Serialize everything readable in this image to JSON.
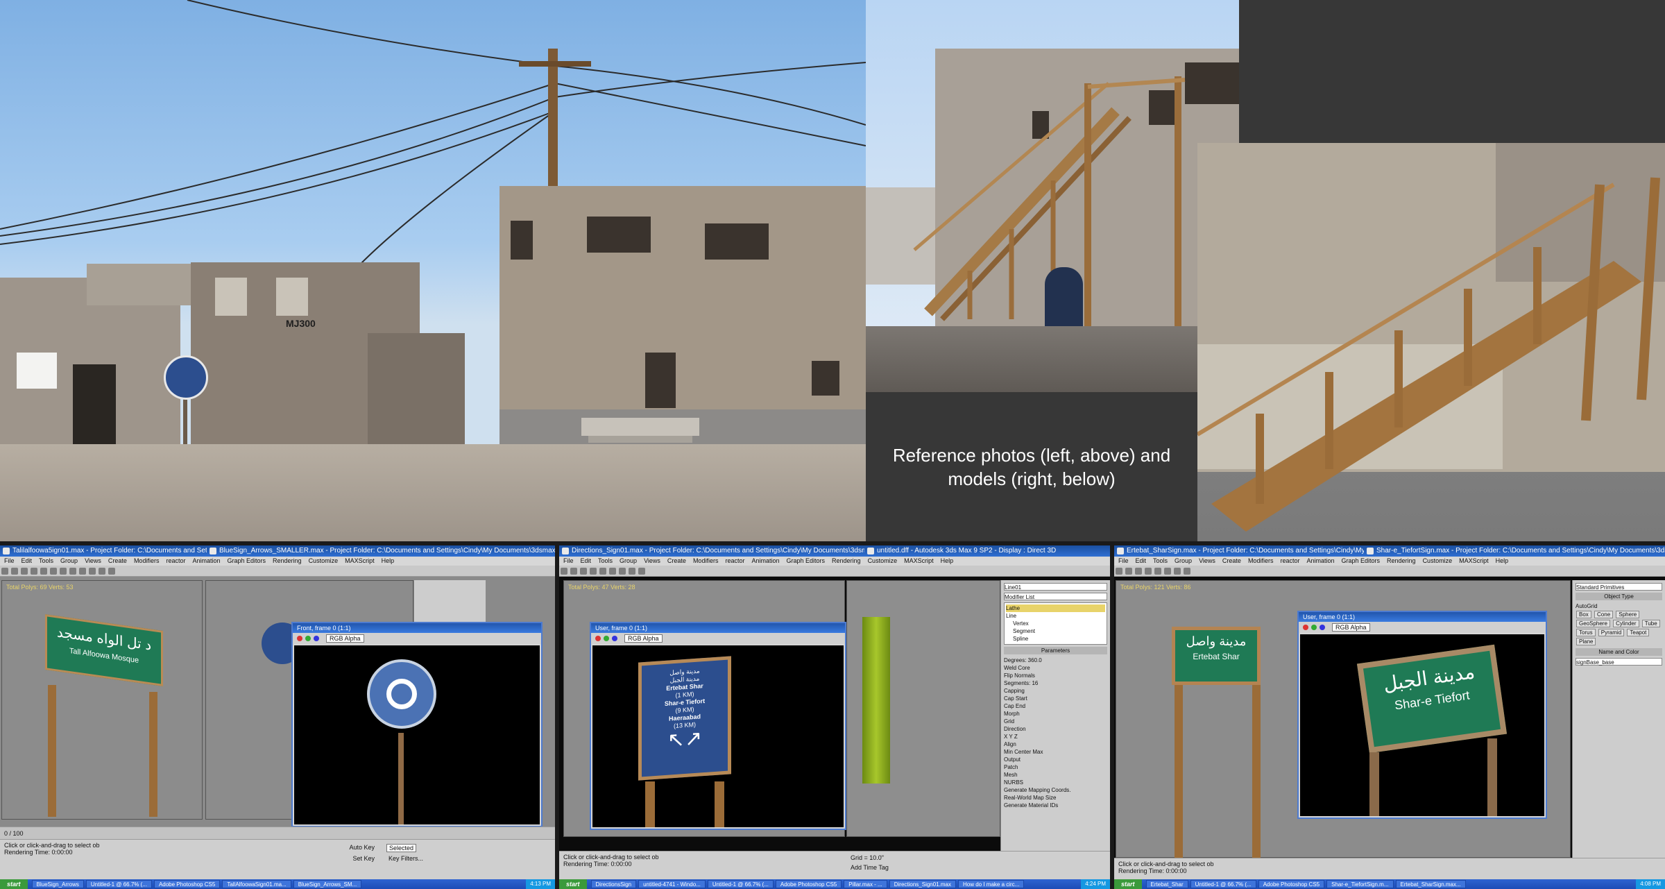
{
  "caption": {
    "line1": "Reference photos (left, above) and",
    "line2": "models (right, below)"
  },
  "colors": {
    "sky": "#8fbbe8",
    "panel_gray": "#373737",
    "sign_blue": "#2c4e8e",
    "sign_green": "#1f7a55",
    "wood": "#9b6c38",
    "titlebar": "#2a62c6",
    "viewport": "#8c8c8c",
    "taskbar": "#245edb"
  },
  "photo": {
    "building_label": "MJ300"
  },
  "screenshots": [
    {
      "title": "Talilalfoowa5ign01.max - Project Folder: C:\\Documents and Settings\\Cindy\\My Documents\\3dsmax",
      "title2": "BlueSign_Arrows_SMALLER.max - Project Folder: C:\\Documents and Settings\\Cindy\\My Documents\\3dsmax",
      "menu": [
        "File",
        "Edit",
        "Tools",
        "Group",
        "Views",
        "Create",
        "Modifiers",
        "reactor",
        "Animation",
        "Graph Editors",
        "Rendering",
        "Customize",
        "MAXScript",
        "Help"
      ],
      "viewport_label": "Total Polys: 69 Verts: 53",
      "sign_text_arabic": "د تل الواه مسجد",
      "sign_text_english": "Tall Alfoowa Mosque",
      "render_title": "Front, frame 0 (1:1)",
      "render_channel": "RGB Alpha",
      "timeline": "0 / 100",
      "status_line1": "Click or click-and-drag to select ob",
      "status_line2": "Rendering Time: 0:00:00",
      "autokey": "Auto Key",
      "selected": "Selected",
      "setkey": "Set Key",
      "keyfilters": "Key Filters...",
      "taskbar": {
        "start": "start",
        "items": [
          "BlueSign_Arrows",
          "Untitled-1 @ 66.7% (...",
          "Adobe Photoshop CS5",
          "TallAlfoowaSign01.ma...",
          "BlueSign_Arrows_SM..."
        ],
        "clock": "4:13 PM"
      }
    },
    {
      "title": "Directions_Sign01.max - Project Folder: C:\\Documents and Settings\\Cindy\\My Documents\\3dsmax - Autodesk 3",
      "title2": "untitled.dff - Autodesk 3ds Max 9 SP2 - Display : Direct 3D",
      "viewport_label": "Total Polys: 47 Verts: 28",
      "render_title": "User, frame 0 (1:1)",
      "render_channel": "RGB Alpha",
      "sign_lines": [
        "مدينة واصل",
        "مدينة الجبل",
        "Ertebat Shar",
        "(1 KM)",
        "Shar-e Tiefort",
        "(9 KM)",
        "Haeraabad",
        "(13 KM)"
      ],
      "cmd_object": "Line01",
      "cmd_modifier": "Modifier List",
      "cmd_stack": [
        "Lathe",
        "Line",
        "Vertex",
        "Segment",
        "Spline"
      ],
      "cmd_params_head": "Parameters",
      "cmd_params": [
        "Degrees: 360.0",
        "Weld Core",
        "Flip Normals",
        "Segments: 16",
        "Capping",
        "Cap Start",
        "Cap End",
        "Morph",
        "Grid",
        "Direction",
        "X  Y  Z",
        "Align",
        "Min  Center  Max",
        "Output",
        "Patch",
        "Mesh",
        "NURBS",
        "Generate Mapping Coords.",
        "Real-World Map Size",
        "Generate Material IDs"
      ],
      "status_line1": "Click or click-and-drag to select ob",
      "status_line2": "Rendering Time: 0:00:00",
      "grid_readout": "Grid = 10.0\"",
      "add_time_tag": "Add Time Tag",
      "taskbar": {
        "start": "start",
        "items": [
          "DirectionsSign",
          "untitled-4741 - Windo...",
          "Untitled-1 @ 66.7% (...",
          "Adobe Photoshop CS5",
          "Pillar.max - ...",
          "Directions_Sign01.max",
          "How do I make a circ..."
        ],
        "clock": "4:24 PM"
      }
    },
    {
      "title": "Ertebat_SharSign.max - Project Folder: C:\\Documents and Settings\\Cindy\\My Documents\\3dsmax - Autodesk 3d",
      "title2": "Shar-e_TiefortSign.max - Project Folder: C:\\Documents and Settings\\Cindy\\My Documents\\3dsmax - Autodesk 3",
      "viewport_label": "Total Polys: 121 Verts: 86",
      "sign_text_arabic": "مدينة واصل",
      "sign_text_english": "Ertebat Shar",
      "render_title": "User, frame 0 (1:1)",
      "render_channel": "RGB Alpha",
      "render_sign_arabic": "مدينة الجبل",
      "render_sign_english": "Shar-e Tiefort",
      "cmd_head1": "Object Type",
      "cmd_autogrid": "AutoGrid",
      "cmd_buttons": [
        "Box",
        "Cone",
        "Sphere",
        "GeoSphere",
        "Cylinder",
        "Tube",
        "Torus",
        "Pyramid",
        "Teapot",
        "Plane"
      ],
      "cmd_head2": "Name and Color",
      "cmd_name": "signBase_base",
      "cmd_category": "Standard Primitives",
      "status_line1": "Click or click-and-drag to select ob",
      "status_line2": "Rendering Time: 0:00:00",
      "taskbar": {
        "start": "start",
        "items": [
          "Ertebat_Shar",
          "Untitled-1 @ 66.7% (...",
          "Adobe Photoshop CS5",
          "Shar-e_TiefortSign.m...",
          "Ertebat_SharSign.max..."
        ],
        "clock": "4:08 PM"
      }
    }
  ]
}
